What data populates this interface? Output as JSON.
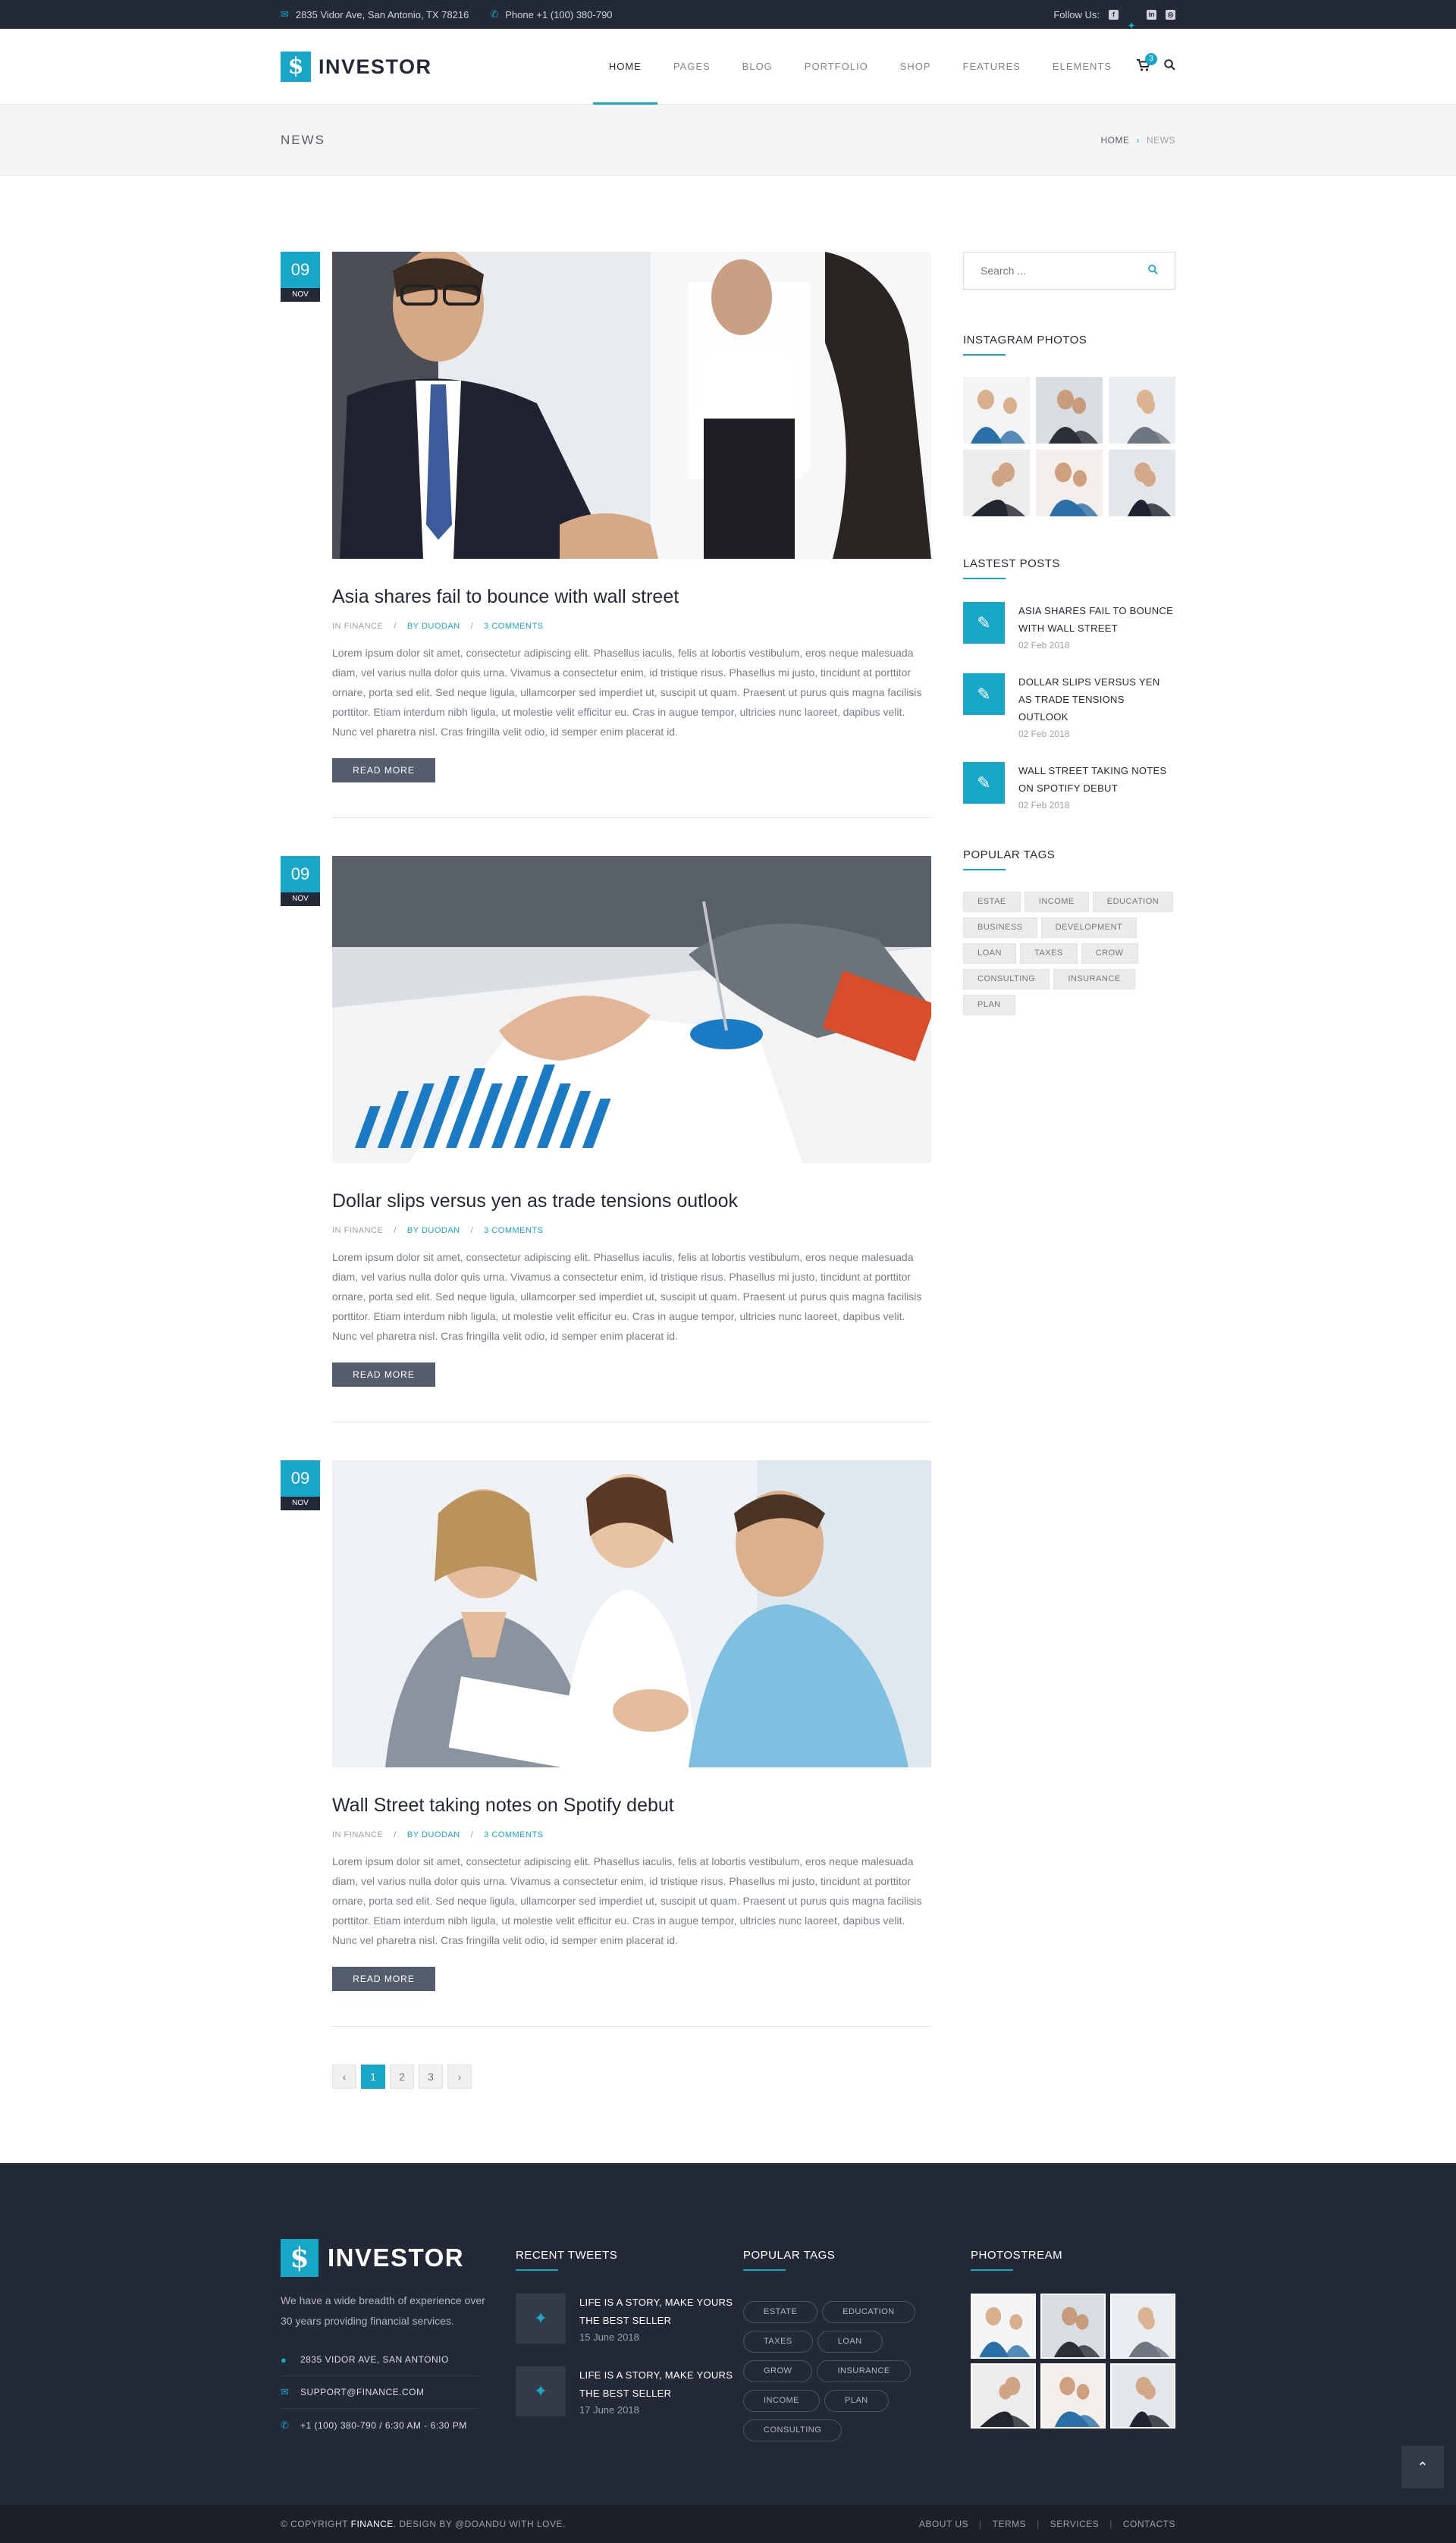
{
  "topbar": {
    "address": "2835 Vidor Ave, San Antonio, TX 78216",
    "phone": "Phone +1 (100) 380-790",
    "follow": "Follow Us:",
    "address_icon": "envelope-icon",
    "phone_icon": "phone-icon",
    "socials": [
      {
        "name": "facebook-icon",
        "glyph": "f"
      },
      {
        "name": "twitter-icon",
        "glyph": "✦"
      },
      {
        "name": "linkedin-icon",
        "glyph": "in"
      },
      {
        "name": "instagram-icon",
        "glyph": "◎"
      }
    ]
  },
  "header": {
    "logo_mark": "$",
    "logo_text": "INVESTOR",
    "nav": [
      "HOME",
      "PAGES",
      "BLOG",
      "PORTFOLIO",
      "SHOP",
      "FEATURES",
      "ELEMENTS"
    ],
    "active": "HOME",
    "cart_count": "3",
    "cart_icon": "cart-icon",
    "search_icon": "search-icon"
  },
  "page_title": {
    "title": "NEWS",
    "crumb_home": "HOME",
    "crumb_sep": "›",
    "crumb_current": "NEWS"
  },
  "posts": [
    {
      "day": "09",
      "month": "NOV",
      "title": "Asia shares fail to bounce with wall street",
      "category": "IN FINANCE",
      "author": "BY DUODAN",
      "comments": "3 COMMENTS",
      "excerpt": "Lorem ipsum dolor sit amet, consectetur adipiscing elit. Phasellus iaculis, felis at lobortis vestibulum, eros neque malesuada diam, vel varius nulla dolor quis urna. Vivamus a consectetur enim, id tristique risus. Phasellus mi justo, tincidunt at porttitor ornare, porta sed elit. Sed neque ligula, ullamcorper sed imperdiet ut, suscipit ut quam. Praesent ut purus quis magna facilisis porttitor. Etiam interdum nibh ligula, ut molestie velit efficitur eu. Cras in augue tempor, ultricies nunc laoreet, dapibus velit. Nunc vel pharetra nisl. Cras fringilla velit odio, id semper enim placerat id.",
      "read_more": "READ MORE"
    },
    {
      "day": "09",
      "month": "NOV",
      "title": "Dollar slips versus yen as trade tensions outlook",
      "category": "IN FINANCE",
      "author": "BY DUODAN",
      "comments": "3 COMMENTS",
      "excerpt": "Lorem ipsum dolor sit amet, consectetur adipiscing elit. Phasellus iaculis, felis at lobortis vestibulum, eros neque malesuada diam, vel varius nulla dolor quis urna. Vivamus a consectetur enim, id tristique risus. Phasellus mi justo, tincidunt at porttitor ornare, porta sed elit. Sed neque ligula, ullamcorper sed imperdiet ut, suscipit ut quam. Praesent ut purus quis magna facilisis porttitor. Etiam interdum nibh ligula, ut molestie velit efficitur eu. Cras in augue tempor, ultricies nunc laoreet, dapibus velit. Nunc vel pharetra nisl. Cras fringilla velit odio, id semper enim placerat id.",
      "read_more": "READ MORE"
    },
    {
      "day": "09",
      "month": "NOV",
      "title": "Wall Street taking notes on Spotify debut",
      "category": "IN FINANCE",
      "author": "BY DUODAN",
      "comments": "3 COMMENTS",
      "excerpt": "Lorem ipsum dolor sit amet, consectetur adipiscing elit. Phasellus iaculis, felis at lobortis vestibulum, eros neque malesuada diam, vel varius nulla dolor quis urna. Vivamus a consectetur enim, id tristique risus. Phasellus mi justo, tincidunt at porttitor ornare, porta sed elit. Sed neque ligula, ullamcorper sed imperdiet ut, suscipit ut quam. Praesent ut purus quis magna facilisis porttitor. Etiam interdum nibh ligula, ut molestie velit efficitur eu. Cras in augue tempor, ultricies nunc laoreet, dapibus velit. Nunc vel pharetra nisl. Cras fringilla velit odio, id semper enim placerat id.",
      "read_more": "READ MORE"
    }
  ],
  "meta_sep": "/",
  "pagination": {
    "prev": "‹",
    "pages": [
      "1",
      "2",
      "3"
    ],
    "current": "1",
    "next": "›"
  },
  "sidebar": {
    "search_placeholder": "Search ...",
    "search_icon": "search-icon",
    "instagram_title": "INSTAGRAM PHOTOS",
    "latest_title": "LASTEST POSTS",
    "latest": [
      {
        "title": "ASIA SHARES FAIL TO BOUNCE WITH WALL STREET",
        "date": "02 Feb 2018"
      },
      {
        "title": "DOLLAR SLIPS VERSUS YEN AS TRADE TENSIONS OUTLOOK",
        "date": "02 Feb 2018"
      },
      {
        "title": "WALL STREET TAKING NOTES ON SPOTIFY DEBUT",
        "date": "02 Feb 2018"
      }
    ],
    "latest_icon": "pencil-icon",
    "tags_title": "POPULAR TAGS",
    "tags": [
      "ESTAE",
      "INCOME",
      "EDUCATION",
      "BUSINESS",
      "DEVELOPMENT",
      "LOAN",
      "TAXES",
      "CROW",
      "CONSULTING",
      "INSURANCE",
      "PLAN"
    ]
  },
  "footer": {
    "logo_mark": "$",
    "logo_text": "INVESTOR",
    "description": "We have a wide breadth of experience over 30 years providing financial services.",
    "contact": [
      {
        "icon": "location-pin-icon",
        "glyph": "●",
        "text": "2835 VIDOR AVE, SAN ANTONIO"
      },
      {
        "icon": "envelope-icon",
        "glyph": "✉",
        "text": "SUPPORT@FINANCE.COM"
      },
      {
        "icon": "phone-icon",
        "glyph": "✆",
        "text": "+1 (100) 380-790  /  6:30 AM - 6:30 PM"
      }
    ],
    "tweets_title": "RECENT TWEETS",
    "tweets": [
      {
        "text": "LIFE IS A STORY, MAKE YOURS THE BEST SELLER",
        "date": "15 June 2018"
      },
      {
        "text": "LIFE IS A STORY, MAKE YOURS THE BEST SELLER",
        "date": "17 June 2018"
      }
    ],
    "tweet_icon": "twitter-icon",
    "tags_title": "POPULAR TAGS",
    "tags": [
      "ESTATE",
      "EDUCATION",
      "TAXES",
      "LOAN",
      "GROW",
      "INSURANCE",
      "INCOME",
      "PLAN",
      "CONSULTING"
    ],
    "photostream_title": "PHOTOSTREAM",
    "to_top": "⌃"
  },
  "copyright": {
    "prefix": "© COPYRIGHT",
    "brand": "FINANCE",
    "suffix": ". DESIGN BY @DOANDU WITH LOVE.",
    "links": [
      "ABOUT US",
      "TERMS",
      "SERVICES",
      "CONTACTS"
    ],
    "sep": "|"
  },
  "colors": {
    "accent": "#18a7c9",
    "dark": "#232936",
    "button": "#555c6b"
  }
}
